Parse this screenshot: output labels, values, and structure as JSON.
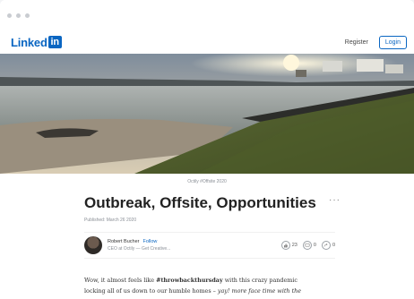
{
  "window": {
    "controls": [
      "close",
      "minimize",
      "maximize"
    ]
  },
  "navbar": {
    "logo_text": "Linked",
    "logo_box": "in",
    "register_label": "Register",
    "login_label": "Login"
  },
  "hero": {
    "caption": "Octily #Offsite 2020"
  },
  "article": {
    "title": "Outbreak, Offsite, Opportunities",
    "more_label": "···",
    "published": "Published: March 26 2020",
    "author": {
      "name": "Robert Bucher",
      "follow_label": "Follow",
      "headline": "CEO at Octily — Get Creative..."
    },
    "stats": {
      "reactions": "23",
      "comments": "0",
      "shares": "0"
    },
    "body": {
      "p1_a": "Wow, it almost feels like ",
      "p1_hashtag": "#throwbackthursday",
      "p1_b": " with this crazy pandemic",
      "p2_a": "locking all of us down to our humble homes – ",
      "p2_italic_a": "yay!",
      "p2_italic_b": " more face time with the"
    }
  },
  "colors": {
    "brand": "#0a66c2",
    "text": "#222222",
    "muted": "#8a8f96"
  }
}
